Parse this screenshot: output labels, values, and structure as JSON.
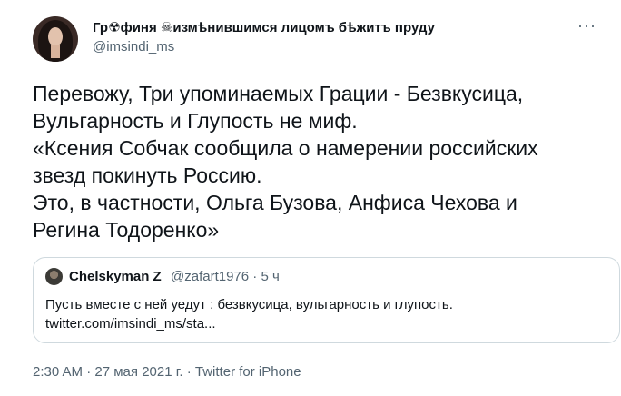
{
  "author": {
    "name_part1": "Гр",
    "name_glyph1": "☢",
    "name_part2": "финя ",
    "name_glyph2": "☠",
    "name_part3": "измѣнившимся лицомъ бѣжитъ пруду",
    "handle": "@imsindi_ms",
    "more_label": "···"
  },
  "tweet": {
    "lines": [
      "Перевожу, Три упоминаемых Грации - Безвкусица,",
      "Вульгарность и Глупость не миф.",
      "«Ксения Собчак сообщила о намерении российских",
      "звезд покинуть Россию.",
      "Это, в частности, Ольга Бузова, Анфиса Чехова и",
      "Регина Тодоренко»"
    ]
  },
  "quoted": {
    "name": "Chelskyman Z",
    "handle_time": "@zafart1976 · 5 ч",
    "lines": [
      "Пусть вместе с ней уедут : безвкусица, вульгарность и глупость.",
      "twitter.com/imsindi_ms/sta..."
    ]
  },
  "meta": {
    "time": "2:30 AM",
    "sep1": " · ",
    "date": "27 мая 2021 г.",
    "sep2": " · ",
    "source": "Twitter for iPhone"
  },
  "colors": {
    "text": "#0f1419",
    "secondary": "#536471",
    "border": "#cfd9de"
  }
}
